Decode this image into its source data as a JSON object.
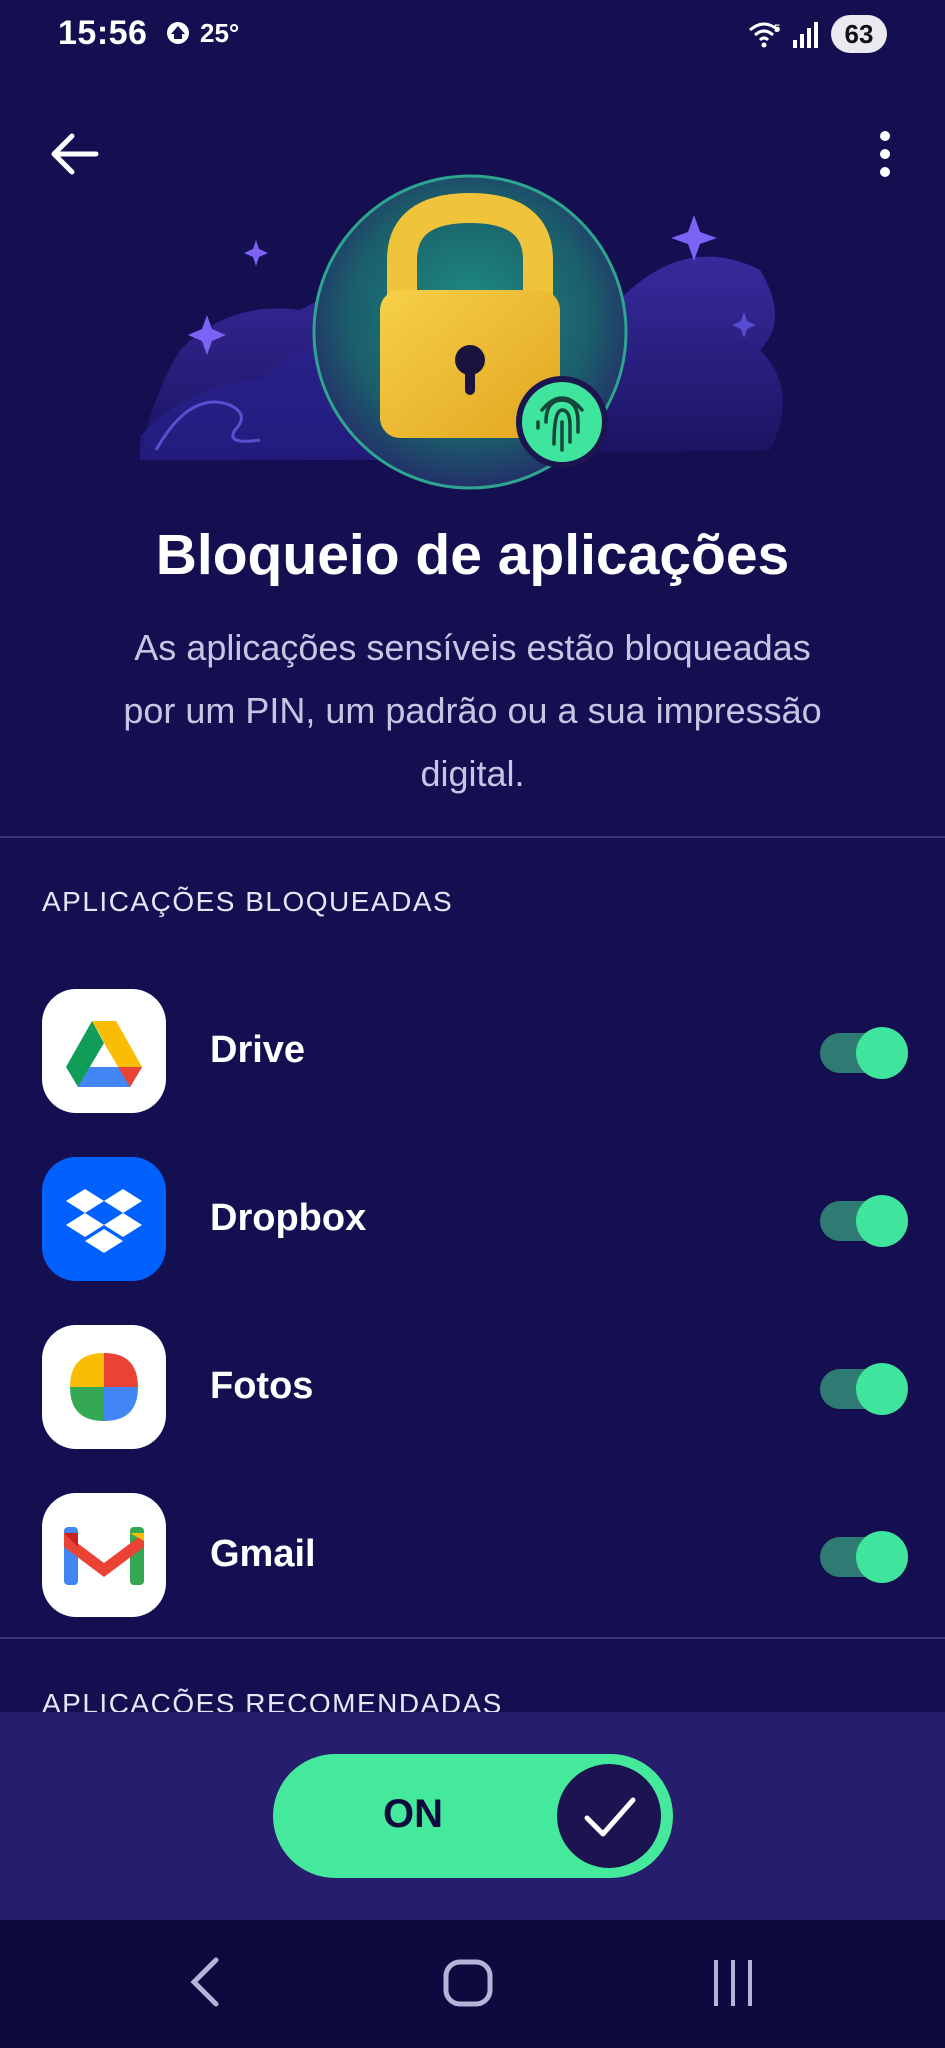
{
  "status_bar": {
    "time": "15:56",
    "temperature": "25°",
    "battery": "63",
    "wifi_badge": "5"
  },
  "header": {
    "back_icon": "arrow-left-icon",
    "menu_icon": "more-vertical-icon"
  },
  "hero": {
    "lock_color": "#f2c233",
    "accent": "#3fe59c",
    "sparkle_color": "#7c63f5"
  },
  "title": "Bloqueio de aplicações",
  "subtitle_lines": [
    "As aplicações sensíveis estão bloqueadas",
    "por um PIN, um padrão ou a sua impressão",
    "digital."
  ],
  "blocked_section": {
    "heading": "APLICAÇÕES BLOQUEADAS",
    "apps": [
      {
        "name": "Drive",
        "icon": "google-drive-icon",
        "enabled": true
      },
      {
        "name": "Dropbox",
        "icon": "dropbox-icon",
        "enabled": true
      },
      {
        "name": "Fotos",
        "icon": "google-photos-icon",
        "enabled": true
      },
      {
        "name": "Gmail",
        "icon": "gmail-icon",
        "enabled": true
      }
    ]
  },
  "recommended_section": {
    "heading": "APLICAÇÕES RECOMENDADAS"
  },
  "master_toggle": {
    "label": "ON",
    "state": true,
    "color": "#44e99c"
  },
  "nav_bar": {
    "icons": [
      "nav-back-icon",
      "nav-home-icon",
      "nav-recent-icon"
    ]
  }
}
